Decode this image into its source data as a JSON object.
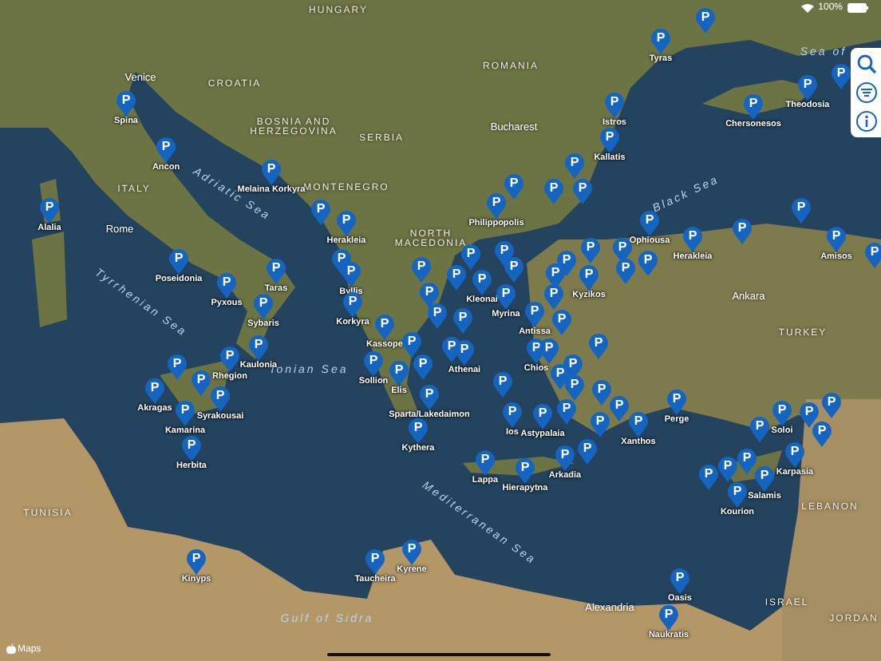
{
  "status_bar": {
    "battery": "100%"
  },
  "map_labels": [
    {
      "text": "HUNGARY",
      "kind": "country"
    },
    {
      "text": "ROMANIA",
      "kind": "country"
    },
    {
      "text": "CROATIA",
      "kind": "country"
    },
    {
      "text": "BOSNIA AND HERZEGOVINA",
      "kind": "country"
    },
    {
      "text": "SERBIA",
      "kind": "country"
    },
    {
      "text": "MONTENEGRO",
      "kind": "country"
    },
    {
      "text": "NORTH MACEDONIA",
      "kind": "country"
    },
    {
      "text": "ITALY",
      "kind": "country"
    },
    {
      "text": "TURKEY",
      "kind": "country"
    },
    {
      "text": "TUNISIA",
      "kind": "country"
    },
    {
      "text": "LEBANON",
      "kind": "country"
    },
    {
      "text": "ISRAEL",
      "kind": "country"
    },
    {
      "text": "JORDAN",
      "kind": "country"
    },
    {
      "text": "Rome",
      "kind": "city"
    },
    {
      "text": "Venice",
      "kind": "city"
    },
    {
      "text": "Bucharest",
      "kind": "city"
    },
    {
      "text": "Ankara",
      "kind": "city"
    },
    {
      "text": "Alexandria",
      "kind": "city"
    },
    {
      "text": "Adriatic Sea",
      "kind": "sea"
    },
    {
      "text": "Tyrrhenian Sea",
      "kind": "sea"
    },
    {
      "text": "Ionian Sea",
      "kind": "sea"
    },
    {
      "text": "Black Sea",
      "kind": "sea"
    },
    {
      "text": "Mediterranean Sea",
      "kind": "sea"
    },
    {
      "text": "Gulf of Sidra",
      "kind": "sea"
    },
    {
      "text": "Sea of",
      "kind": "sea"
    }
  ],
  "pins": [
    {
      "letter": "P",
      "label": "Spina"
    },
    {
      "letter": "P",
      "label": "Ancon"
    },
    {
      "letter": "P",
      "label": "Alalia"
    },
    {
      "letter": "P",
      "label": "Melaina Korkyra"
    },
    {
      "letter": "P"
    },
    {
      "letter": "P",
      "label": "Herakleia"
    },
    {
      "letter": "P",
      "label": "Tyras"
    },
    {
      "letter": "P"
    },
    {
      "letter": "P",
      "label": "Istros"
    },
    {
      "letter": "P"
    },
    {
      "letter": "P",
      "label": "Kallatis"
    },
    {
      "letter": "P",
      "label": "Philippopolis"
    },
    {
      "letter": "P"
    },
    {
      "letter": "P"
    },
    {
      "letter": "P"
    },
    {
      "letter": "P",
      "label": "Ophiousa"
    },
    {
      "letter": "P"
    },
    {
      "letter": "P",
      "label": "Chersonesos"
    },
    {
      "letter": "P",
      "label": "Theodosia"
    },
    {
      "letter": "P"
    },
    {
      "letter": "P",
      "label": "Poseidonia"
    },
    {
      "letter": "P",
      "label": "Pyxous"
    },
    {
      "letter": "P",
      "label": "Taras"
    },
    {
      "letter": "P",
      "label": "Sybaris"
    },
    {
      "letter": "P"
    },
    {
      "letter": "P",
      "label": "Rhegion"
    },
    {
      "letter": "P",
      "label": "Kaulonia"
    },
    {
      "letter": "P",
      "label": "Akragas"
    },
    {
      "letter": "P"
    },
    {
      "letter": "P",
      "label": "Kamarina"
    },
    {
      "letter": "P",
      "label": "Syrakousai"
    },
    {
      "letter": "P",
      "label": "Herbita"
    },
    {
      "letter": "P"
    },
    {
      "letter": "P",
      "label": "Byllis"
    },
    {
      "letter": "P",
      "label": "Korkyra"
    },
    {
      "letter": "P",
      "label": "Kassope"
    },
    {
      "letter": "P",
      "label": "Sollion"
    },
    {
      "letter": "P"
    },
    {
      "letter": "P",
      "label": "Elis"
    },
    {
      "letter": "P"
    },
    {
      "letter": "P",
      "label": "Sparta/Lakedaimon"
    },
    {
      "letter": "P"
    },
    {
      "letter": "P"
    },
    {
      "letter": "P"
    },
    {
      "letter": "P"
    },
    {
      "letter": "P"
    },
    {
      "letter": "P"
    },
    {
      "letter": "P"
    },
    {
      "letter": "P",
      "label": "Kleonai"
    },
    {
      "letter": "P",
      "label": "Myrina"
    },
    {
      "letter": "P"
    },
    {
      "letter": "P"
    },
    {
      "letter": "P"
    },
    {
      "letter": "P"
    },
    {
      "letter": "P"
    },
    {
      "letter": "P",
      "label": "Kyzikos"
    },
    {
      "letter": "P"
    },
    {
      "letter": "P"
    },
    {
      "letter": "P",
      "label": "Herakleia"
    },
    {
      "letter": "P"
    },
    {
      "letter": "P",
      "label": "Amisos"
    },
    {
      "letter": "P"
    },
    {
      "letter": "P"
    },
    {
      "letter": "P",
      "label": "Antissa"
    },
    {
      "letter": "P"
    },
    {
      "letter": "P",
      "label": "Chios"
    },
    {
      "letter": "P"
    },
    {
      "letter": "P"
    },
    {
      "letter": "P"
    },
    {
      "letter": "P"
    },
    {
      "letter": "P"
    },
    {
      "letter": "P"
    },
    {
      "letter": "P"
    },
    {
      "letter": "P",
      "label": "Ios"
    },
    {
      "letter": "P",
      "label": "Astypalaia"
    },
    {
      "letter": "P"
    },
    {
      "letter": "P"
    },
    {
      "letter": "P"
    },
    {
      "letter": "P",
      "label": "Xanthos"
    },
    {
      "letter": "P"
    },
    {
      "letter": "P",
      "label": "Perge"
    },
    {
      "letter": "P"
    },
    {
      "letter": "P",
      "label": "Soloi"
    },
    {
      "letter": "P"
    },
    {
      "letter": "P"
    },
    {
      "letter": "P"
    },
    {
      "letter": "P",
      "label": "Lappa"
    },
    {
      "letter": "P",
      "label": "Hierapytna"
    },
    {
      "letter": "P",
      "label": "Arkadia"
    },
    {
      "letter": "P"
    },
    {
      "letter": "P"
    },
    {
      "letter": "P"
    },
    {
      "letter": "P",
      "label": "Kourion"
    },
    {
      "letter": "P",
      "label": "Salamis"
    },
    {
      "letter": "P",
      "label": "Karpasia"
    },
    {
      "letter": "P",
      "label": "Oasis"
    },
    {
      "letter": "P",
      "label": "Naukratis"
    },
    {
      "letter": "P",
      "label": "Kinyps"
    },
    {
      "letter": "P",
      "label": "Taucheira"
    },
    {
      "letter": "P",
      "label": "Kyrene"
    },
    {
      "letter": "P"
    },
    {
      "letter": "P",
      "label": "Athenai"
    },
    {
      "letter": "P",
      "label": "Kythera"
    }
  ],
  "attribution": "Maps"
}
